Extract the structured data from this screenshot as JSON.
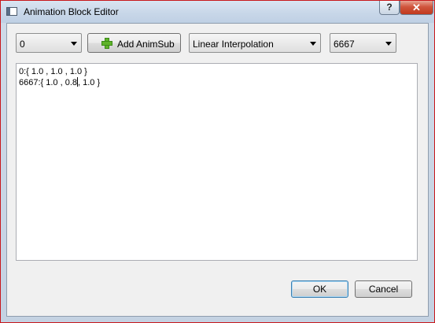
{
  "window": {
    "title": "Animation Block Editor",
    "help_label": "?",
    "close_label": "✕"
  },
  "toolbar": {
    "timestamp_combo": {
      "selected": "0"
    },
    "add_button": {
      "label": "Add AnimSub",
      "icon": "green-plus-icon"
    },
    "interpolation_combo": {
      "selected": "Linear Interpolation"
    },
    "key_combo": {
      "selected": "6667"
    }
  },
  "editor": {
    "lines": [
      {
        "text": "0:{ 1.0 , 1.0 , 1.0 }"
      },
      {
        "text_before_caret": "6667:{ 1.0 , 0.8",
        "text_after_caret": ", 1.0 }"
      }
    ]
  },
  "buttons": {
    "ok": "OK",
    "cancel": "Cancel"
  },
  "colors": {
    "window_border": "#c8171b",
    "close_button": "#c1391d",
    "plus_icon": "#5fb32a"
  }
}
